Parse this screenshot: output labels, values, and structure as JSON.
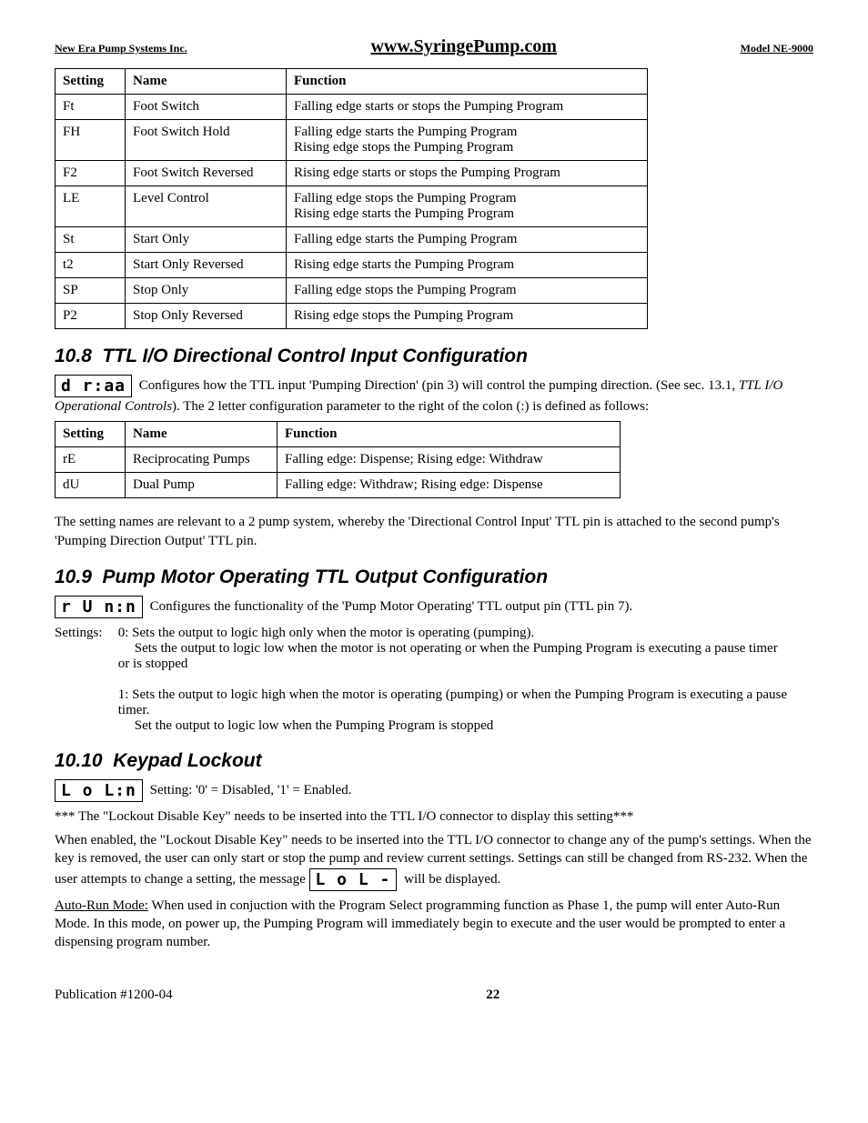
{
  "header": {
    "left": "New Era Pump Systems Inc.",
    "center": "www.SyringePump.com",
    "right": "Model NE-9000"
  },
  "table1": {
    "headers": {
      "setting": "Setting",
      "name": "Name",
      "function": "Function"
    },
    "rows": [
      {
        "setting": "Ft",
        "name": "Foot Switch",
        "function": "Falling edge starts or stops the Pumping Program"
      },
      {
        "setting": "FH",
        "name": "Foot Switch Hold",
        "function": "Falling edge starts the Pumping Program\nRising edge stops the Pumping Program"
      },
      {
        "setting": "F2",
        "name": "Foot Switch Reversed",
        "function": "Rising edge starts or stops the Pumping Program"
      },
      {
        "setting": "LE",
        "name": "Level Control",
        "function": "Falling edge stops the Pumping Program\nRising edge starts the Pumping Program"
      },
      {
        "setting": "St",
        "name": "Start Only",
        "function": "Falling edge starts the Pumping Program"
      },
      {
        "setting": "t2",
        "name": "Start Only Reversed",
        "function": "Rising edge starts the Pumping Program"
      },
      {
        "setting": "SP",
        "name": "Stop Only",
        "function": "Falling edge stops the Pumping Program"
      },
      {
        "setting": "P2",
        "name": "Stop Only Reversed",
        "function": "Rising edge stops the Pumping Program"
      }
    ]
  },
  "sec108": {
    "title_num": "10.8",
    "title_text": "TTL I/O Directional Control Input Configuration",
    "lcd": "d r:aa",
    "para1a": " Configures how the TTL input 'Pumping Direction' (pin 3) will control the pumping direction.  (See sec. 13.1, ",
    "para1_em": "TTL I/O Operational Controls",
    "para1b": ").  The 2 letter configuration parameter to the right of the colon (:) is defined as follows:",
    "table": {
      "headers": {
        "setting": "Setting",
        "name": "Name",
        "function": "Function"
      },
      "rows": [
        {
          "setting": "rE",
          "name": "Reciprocating Pumps",
          "function": "Falling edge: Dispense; Rising edge: Withdraw"
        },
        {
          "setting": "dU",
          "name": "Dual Pump",
          "function": "Falling edge: Withdraw; Rising edge: Dispense"
        }
      ]
    },
    "para2": "The setting names are relevant to a 2 pump system, whereby the 'Directional Control Input' TTL pin is attached to the second pump's 'Pumping Direction Output' TTL pin."
  },
  "sec109": {
    "title_num": "10.9",
    "title_text": "Pump Motor Operating TTL Output Configuration",
    "lcd": "r U n:n",
    "para1": "Configures the functionality of the 'Pump Motor Operating' TTL output pin (TTL pin 7).",
    "settings_label": "Settings:",
    "s0_lead": "0: Sets the output to logic high only when the motor is operating (pumping).",
    "s0_line2": "Sets the output to logic low when the motor is not operating or when the Pumping Program is executing a pause timer or is stopped",
    "s1_lead": "1: Sets the output to logic high when the motor is operating (pumping) or when the Pumping Program is executing a pause timer.",
    "s1_line2": "Set the output to logic low when the Pumping Program is stopped"
  },
  "sec1010": {
    "title_num": "10.10",
    "title_text": "Keypad Lockout",
    "lcd": "L o L:n",
    "setting_line": "Setting:  '0' = Disabled, '1' = Enabled.",
    "note": " *** The \"Lockout Disable Key\" needs to be inserted into the TTL I/O connector to display this setting***",
    "para2a": "When enabled, the \"Lockout Disable Key\" needs to be inserted into the TTL I/O connector to change any of the pump's settings.  When the key is removed, the user can only start or stop the pump and review current settings.  Settings can still be changed from RS-232.  When the user attempts to change a setting, the message ",
    "lcd2": "L o L -",
    "para2b": " will be displayed.",
    "autorun_label": "Auto-Run Mode:",
    "autorun_text": "  When used in conjuction with the Program Select programming function as Phase 1, the pump will enter Auto-Run Mode.  In this mode, on power up, the Pumping Program will immediately begin to execute and the user would be prompted to enter a dispensing program number."
  },
  "footer": {
    "left": "Publication #1200-04",
    "center": "22",
    "right": ""
  }
}
